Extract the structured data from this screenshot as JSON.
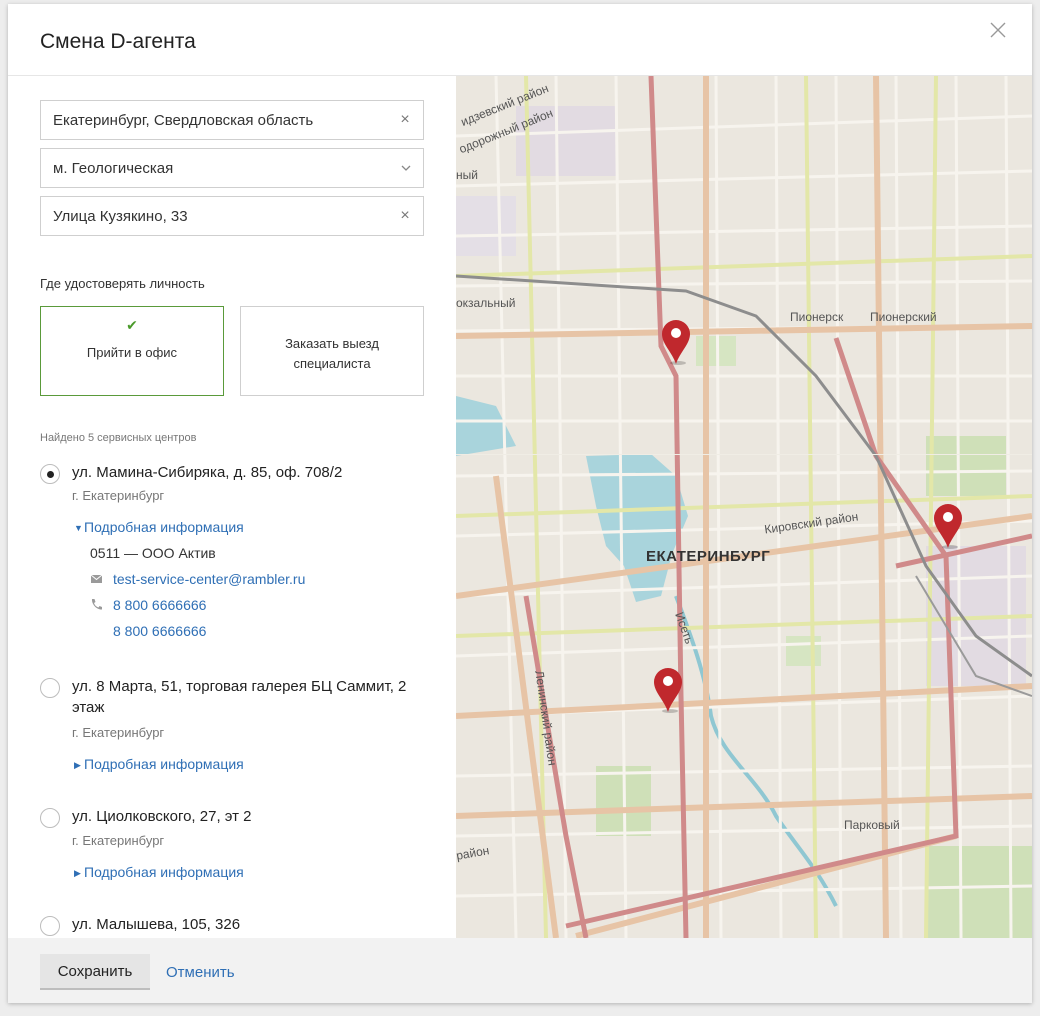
{
  "dialog": {
    "title": "Смена D-агента"
  },
  "fields": {
    "city": "Екатеринбург, Свердловская область",
    "metro": "м. Геологическая",
    "street": "Улица Кузякино, 33"
  },
  "identity": {
    "label": "Где удостоверять личность",
    "office": "Прийти в офис",
    "visit_line1": "Заказать выезд",
    "visit_line2": "специалиста",
    "selected": "office"
  },
  "found_text": "Найдено 5 сервисных центров",
  "centers": [
    {
      "address": "ул. Мамина-Сибиряка, д. 85, оф. 708/2",
      "city": "г. Екатеринбург",
      "details_label": "Подробная информация",
      "expanded": true,
      "selected": true,
      "org": "0511 — ООО Актив",
      "email": "test-service-center@rambler.ru",
      "phones": [
        "8 800 6666666",
        "8 800 6666666"
      ]
    },
    {
      "address": "ул. 8 Марта, 51, торговая галерея БЦ Саммит, 2 этаж",
      "city": "г. Екатеринбург",
      "details_label": "Подробная информация",
      "expanded": false,
      "selected": false
    },
    {
      "address": "ул. Циолковского, 27, эт 2",
      "city": "г. Екатеринбург",
      "details_label": "Подробная информация",
      "expanded": false,
      "selected": false
    },
    {
      "address": "ул. Малышева, 105, 326",
      "selected": false
    }
  ],
  "footer": {
    "save": "Сохранить",
    "cancel": "Отменить"
  },
  "map": {
    "labels": {
      "city": "ЕКАТЕРИНБУРГ",
      "kirov": "Кировский район",
      "pioner1": "Пионерск",
      "pioner2": "Пионерский",
      "park": "Парковый",
      "lenin": "Ленинский район",
      "iset": "Исеть",
      "zhd": "одорожный район",
      "dzer": "идзевский район",
      "vokz": "окзальный",
      "nyi": "ный",
      "rayon": "район"
    },
    "pin_color": "#c0282d",
    "pins": 3
  },
  "colors": {
    "accent": "#2f6fb5",
    "selected_border": "#5a9a3a",
    "check": "#4a9a2a"
  }
}
